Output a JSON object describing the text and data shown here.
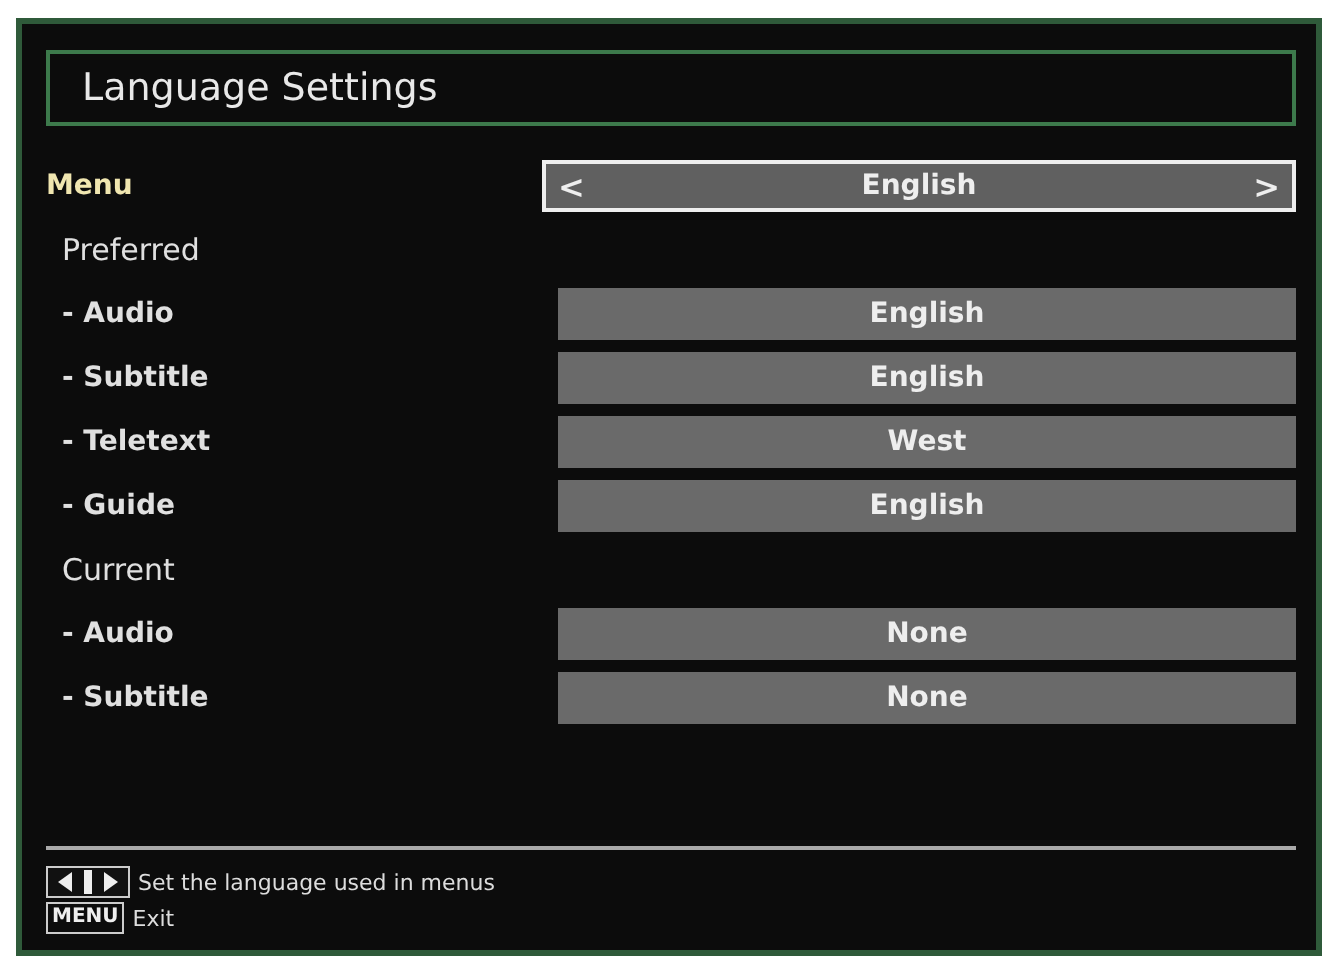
{
  "title": "Language Settings",
  "rows": [
    {
      "kind": "setting",
      "label": "Menu",
      "value": "English",
      "selected": true,
      "prev": "<",
      "next": ">"
    },
    {
      "kind": "header",
      "label": "Preferred"
    },
    {
      "kind": "setting",
      "label": "- Audio",
      "value": "English",
      "selected": false
    },
    {
      "kind": "setting",
      "label": "- Subtitle",
      "value": "English",
      "selected": false
    },
    {
      "kind": "setting",
      "label": "- Teletext",
      "value": "West",
      "selected": false
    },
    {
      "kind": "setting",
      "label": "- Guide",
      "value": "English",
      "selected": false
    },
    {
      "kind": "header",
      "label": "Current"
    },
    {
      "kind": "setting",
      "label": "- Audio",
      "value": "None",
      "selected": false
    },
    {
      "kind": "setting",
      "label": "- Subtitle",
      "value": "None",
      "selected": false
    }
  ],
  "hints": [
    {
      "kind": "arrows",
      "text": "Set the language used in menus"
    },
    {
      "kind": "key",
      "key": "MENU",
      "text": "Exit"
    }
  ]
}
